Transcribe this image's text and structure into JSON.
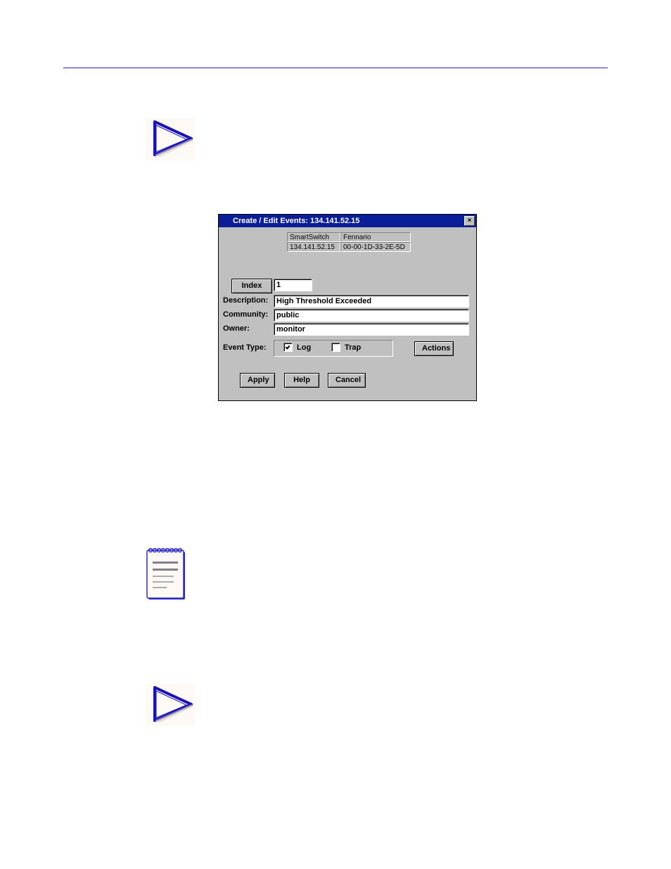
{
  "dialog": {
    "title": "Create / Edit Events: 134.141.52.15",
    "close_symbol": "×",
    "info": {
      "device_type": "SmartSwitch",
      "device_name": "Fennario",
      "ip": "134.141.52.15",
      "mac": "00-00-1D-33-2E-5D"
    },
    "labels": {
      "index": "Index",
      "description": "Description:",
      "community": "Community:",
      "owner": "Owner:",
      "event_type": "Event Type:"
    },
    "fields": {
      "index": "1",
      "description": "High Threshold Exceeded",
      "community": "public",
      "owner": "monitor"
    },
    "checks": {
      "log_label": "Log",
      "log_checked": true,
      "trap_label": "Trap",
      "trap_checked": false
    },
    "buttons": {
      "actions": "Actions",
      "apply": "Apply",
      "help": "Help",
      "cancel": "Cancel"
    }
  }
}
